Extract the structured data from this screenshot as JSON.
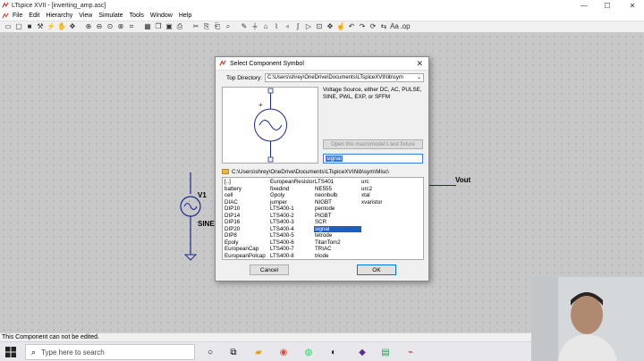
{
  "window": {
    "title": "LTspice XVII - [inverting_amp.asc]",
    "controls": {
      "minimize": "—",
      "maximize": "☐",
      "close": "✕"
    }
  },
  "menu": {
    "items": [
      "File",
      "Edit",
      "Hierarchy",
      "View",
      "Simulate",
      "Tools",
      "Window",
      "Help"
    ]
  },
  "toolbar": {
    "icons": [
      "open-icon",
      "new-icon",
      "save-icon",
      "control-panel-icon",
      "run-icon",
      "halt-icon",
      "pan-icon",
      "zoom-in-icon",
      "zoom-out-icon",
      "zoom-full-icon",
      "zoom-cancel-icon",
      "autorange-icon",
      "tile-icon",
      "cascade-icon",
      "close-icon",
      "print-icon",
      "cut-icon",
      "copy-icon",
      "paste-icon",
      "find-icon",
      "wire-icon",
      "ground-icon",
      "label-icon",
      "resistor-icon",
      "capacitor-icon",
      "inductor-icon",
      "diode-icon",
      "component-icon",
      "move-icon",
      "drag-icon",
      "undo-icon",
      "redo-icon",
      "rotate-icon",
      "mirror-icon",
      "text-icon",
      "spice-directive-icon"
    ]
  },
  "schematic": {
    "source_name": "V1",
    "source_value": "SINE",
    "output_label": "Vout"
  },
  "dialog": {
    "title": "Select Component Symbol",
    "top_directory_label": "Top Directory:",
    "top_directory_value": "C:\\Users\\shrey\\OneDrive\\Documents\\LTspiceXVII\\lib\\sym",
    "description": "Voltage Source, either DC, AC, PULSE, SINE, PWL, EXP, or SFFM",
    "test_button": "Open this macromodel's test fixture",
    "search_value": "signal",
    "current_path": "C:\\Users\\shrey\\OneDrive\\Documents\\LTspiceXVII\\lib\\sym\\Misc\\",
    "columns": [
      [
        "[..]",
        "battery",
        "cell",
        "DIAC",
        "DIP10",
        "DIP14",
        "DIP16",
        "DIP20",
        "DIP8",
        "Epoly",
        "EuropeanCap",
        "EuropeanPolcap"
      ],
      [
        "EuropeanResistor",
        "fixedind",
        "Gpoly",
        "jumper",
        "LTS400-1",
        "LTS400-2",
        "LTS400-3",
        "LTS400-4",
        "LTS400-5",
        "LTS400-6",
        "LTS400-7",
        "LTS400-8"
      ],
      [
        "LTS401",
        "NE555",
        "neonbulb",
        "NIGBT",
        "pentode",
        "PIGBT",
        "SCR",
        "signal",
        "tetrode",
        "TitanTom2",
        "TRIAC",
        "triode"
      ],
      [
        "urc",
        "urc2",
        "xtal",
        "xvaristor"
      ]
    ],
    "selected_item": "signal",
    "cancel_label": "Cancel",
    "ok_label": "OK"
  },
  "statusbar": {
    "text": "This Component can not be edited."
  },
  "taskbar": {
    "search_placeholder": "Type here to search"
  },
  "colors": {
    "wire": "#1e2a8c",
    "selection": "#1a5fc4",
    "canvas": "#c8c8c8"
  }
}
